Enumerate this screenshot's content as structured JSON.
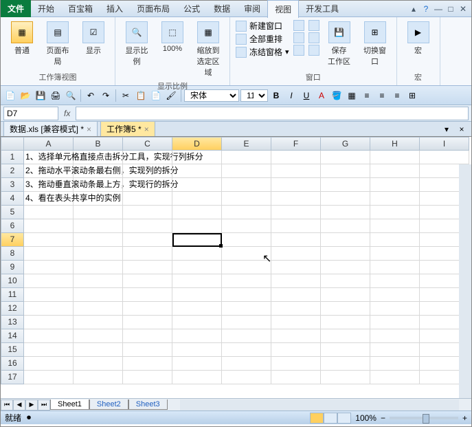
{
  "menu": {
    "file": "文件",
    "tabs": [
      "开始",
      "百宝箱",
      "插入",
      "页面布局",
      "公式",
      "数据",
      "审阅",
      "视图",
      "开发工具"
    ],
    "active": 7
  },
  "ribbon": {
    "g1": {
      "label": "工作簿视图",
      "normal": "普通",
      "layout": "页面布局",
      "show": "显示"
    },
    "g2": {
      "label": "显示比例",
      "zoom": "显示比例",
      "p100": "100%",
      "zoomsel": "缩放到\n选定区域"
    },
    "g3": {
      "label": "窗口",
      "newwin": "新建窗口",
      "arrange": "全部重排",
      "freeze": "冻结窗格",
      "save": "保存\n工作区",
      "switch": "切换窗口"
    },
    "g4": {
      "label": "宏",
      "macro": "宏"
    }
  },
  "quickbar": {
    "font": "宋体",
    "size": "11"
  },
  "namebox": "D7",
  "doctabs": [
    {
      "label": "数据.xls  [兼容模式] *"
    },
    {
      "label": "工作簿5 *",
      "active": true
    }
  ],
  "columns": [
    "A",
    "B",
    "C",
    "D",
    "E",
    "F",
    "G",
    "H",
    "I"
  ],
  "activeCol": 3,
  "activeRow": 6,
  "rows": [
    1,
    2,
    3,
    4,
    5,
    6,
    7,
    8,
    9,
    10,
    11,
    12,
    13,
    14,
    15,
    16,
    17
  ],
  "celldata": {
    "1": "1、选择单元格直接点击拆分工具，实现行列拆分",
    "2": "2、拖动水平滚动条最右侧，实现列的拆分",
    "3": "3、拖动垂直滚动条最上方，实现行的拆分",
    "4": "4、看在表头共享中的实例"
  },
  "sheets": [
    "Sheet1",
    "Sheet2",
    "Sheet3"
  ],
  "activeSheet": 0,
  "status": "就绪",
  "zoom": "100%"
}
